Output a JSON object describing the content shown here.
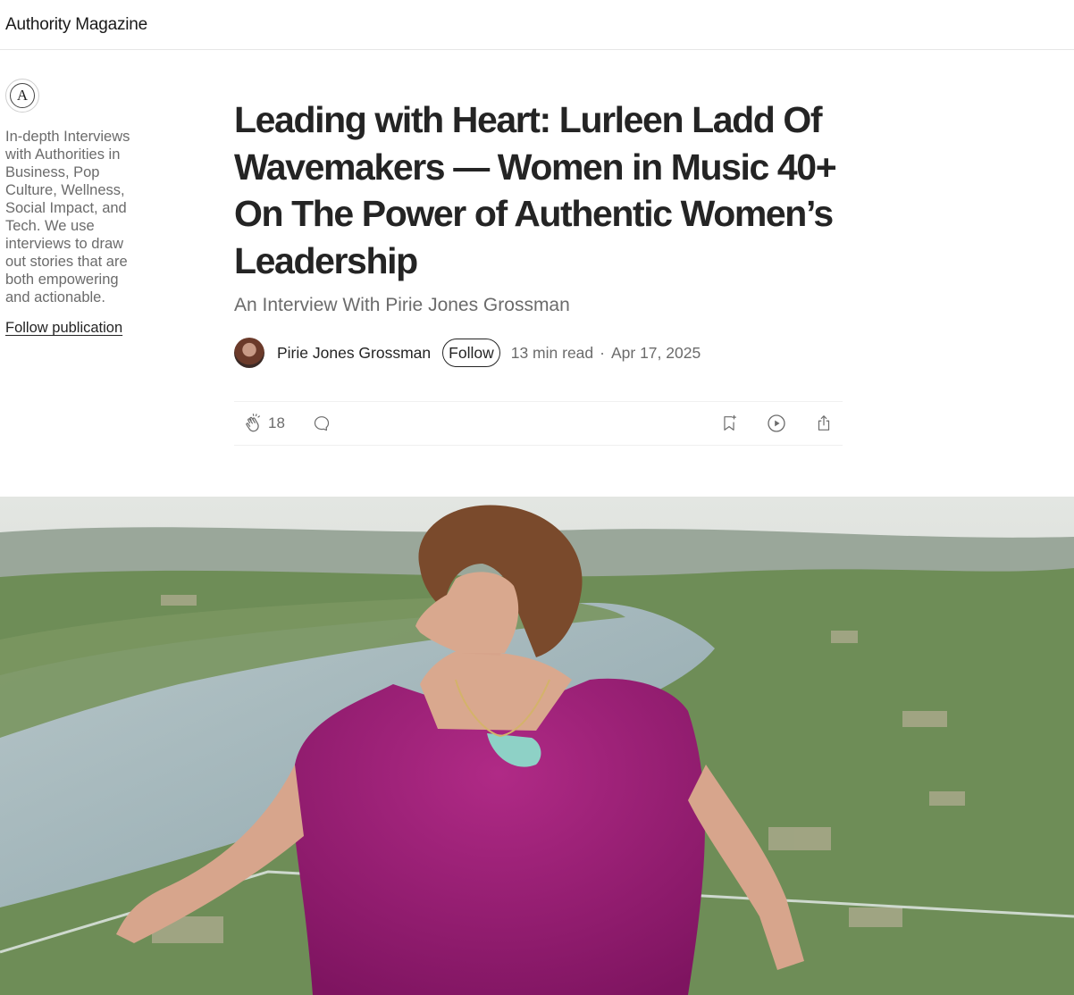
{
  "header": {
    "brand": "Authority Magazine"
  },
  "sidebar": {
    "logo_letter": "A",
    "description": "In-depth Interviews with Authorities in Business, Pop Culture, Wellness, Social Impact, and Tech. We use interviews to draw out stories that are both empowering and actionable.",
    "follow_label": "Follow publication"
  },
  "article": {
    "title": "Leading with Heart: Lurleen Ladd Of Wavemakers — Women in Music 40+ On The Power of Authentic Women’s Leadership",
    "subtitle": "An Interview With Pirie Jones Grossman",
    "author": "Pirie Jones Grossman",
    "follow_label": "Follow",
    "read_time": "13 min read",
    "separator": "·",
    "date": "Apr 17, 2025"
  },
  "actions": {
    "clap_count": "18",
    "icons": [
      "clap-icon",
      "comment-icon",
      "bookmark-icon",
      "play-icon",
      "share-icon"
    ]
  },
  "hero": {
    "description_colors": {
      "sky": "#dfe2df",
      "hills": "#6f8d58",
      "river": "#a9bcc2",
      "dress": "#9e1f74",
      "hair": "#7a4a2c",
      "skin": "#d9a88e"
    }
  }
}
